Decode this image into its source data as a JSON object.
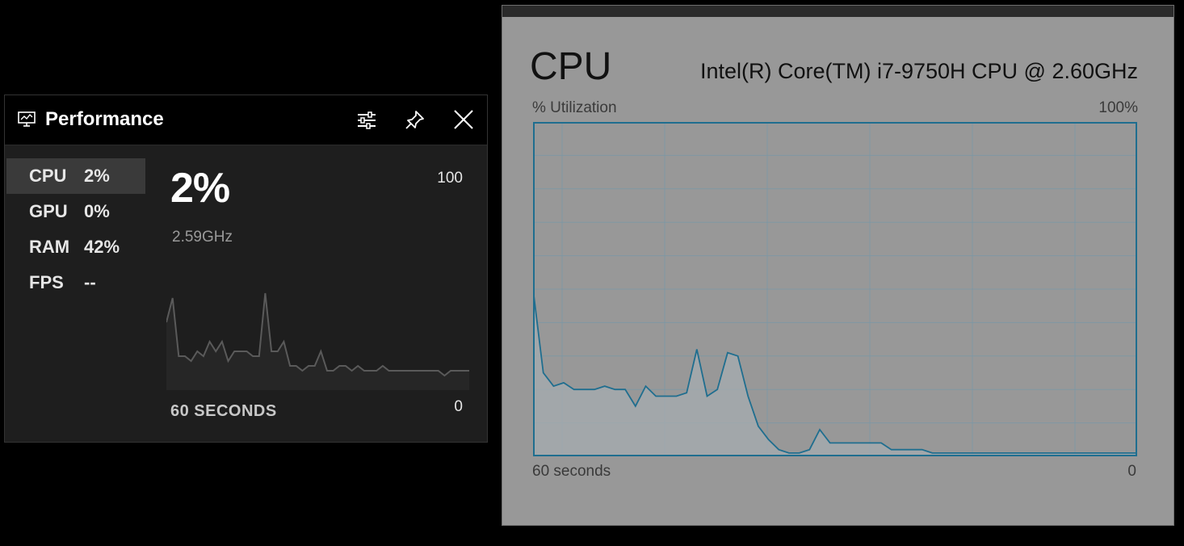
{
  "performance_widget": {
    "title": "Performance",
    "metrics": [
      {
        "name": "CPU",
        "value": "2%"
      },
      {
        "name": "GPU",
        "value": "0%"
      },
      {
        "name": "RAM",
        "value": "42%"
      },
      {
        "name": "FPS",
        "value": "--"
      }
    ],
    "selected_metric": "CPU",
    "current_value": "2%",
    "frequency": "2.59GHz",
    "max_label": "100",
    "min_label": "0",
    "time_window_label": "60 SECONDS",
    "history": [
      14,
      19,
      7,
      7,
      6,
      8,
      7,
      10,
      8,
      10,
      6,
      8,
      8,
      8,
      7,
      7,
      20,
      8,
      8,
      10,
      5,
      5,
      4,
      5,
      5,
      8,
      4,
      4,
      5,
      5,
      4,
      5,
      4,
      4,
      4,
      5,
      4,
      4,
      4,
      4,
      4,
      4,
      4,
      4,
      4,
      3,
      4,
      4,
      4,
      4
    ],
    "icons": {
      "app": "performance-monitor-icon",
      "settings": "sliders-icon",
      "pin": "pin-icon",
      "close": "close-icon"
    }
  },
  "task_manager": {
    "title": "CPU",
    "model": "Intel(R) Core(TM) i7-9750H CPU @ 2.60GHz",
    "y_axis_label": "% Utilization",
    "y_max_label": "100%",
    "x_axis_label": "60 seconds",
    "x_min_label": "0",
    "line_color": "#1f6e8f",
    "background_color": "#989898",
    "utilization": [
      50,
      25,
      21,
      22,
      20,
      20,
      20,
      21,
      20,
      20,
      15,
      21,
      18,
      18,
      18,
      19,
      32,
      18,
      20,
      31,
      30,
      18,
      9,
      5,
      2,
      1,
      1,
      2,
      8,
      4,
      4,
      4,
      4,
      4,
      4,
      2,
      2,
      2,
      2,
      1,
      1,
      1,
      1,
      1,
      1,
      1,
      1,
      1,
      1,
      1,
      1,
      1,
      1,
      1,
      1,
      1,
      1,
      1,
      1,
      1
    ]
  }
}
